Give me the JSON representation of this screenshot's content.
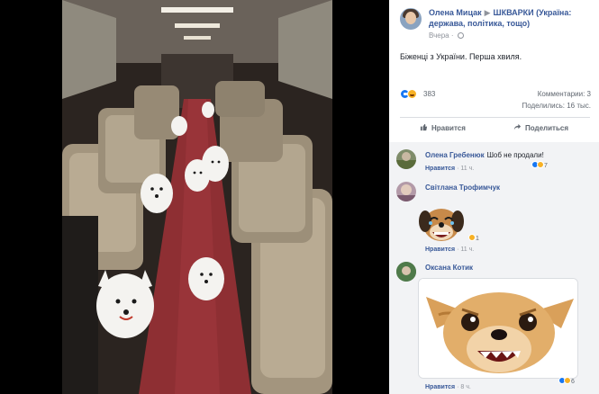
{
  "post": {
    "author": "Олена Мицак",
    "group": "ШКВАРКИ (Україна: держава, політика, тощо)",
    "time": "Вчера",
    "text": "Біженці з України. Перша хвиля.",
    "reactions_count": "383",
    "comments_label": "Комментарии: 3",
    "shares_label": "Поделились: 16 тыс.",
    "like_action": "Нравится",
    "share_action": "Поделиться"
  },
  "comments": [
    {
      "author": "Олена Гребенюк",
      "text": "Шоб не продали!",
      "like_link": "Нравится",
      "time": "11 ч.",
      "reactions": "7"
    },
    {
      "author": "Світлана Трофимчук",
      "like_link": "Нравится",
      "time": "11 ч.",
      "reactions": "1"
    },
    {
      "author": "Оксана Котик",
      "like_link": "Нравится",
      "time": "8 ч.",
      "reactions": "6"
    }
  ],
  "icons": {
    "globe": "globe-icon",
    "like": "thumbs-up-icon",
    "share": "share-arrow-icon"
  },
  "colors": {
    "link": "#385898",
    "like": "#1877f2",
    "haha": "#f7b125"
  }
}
